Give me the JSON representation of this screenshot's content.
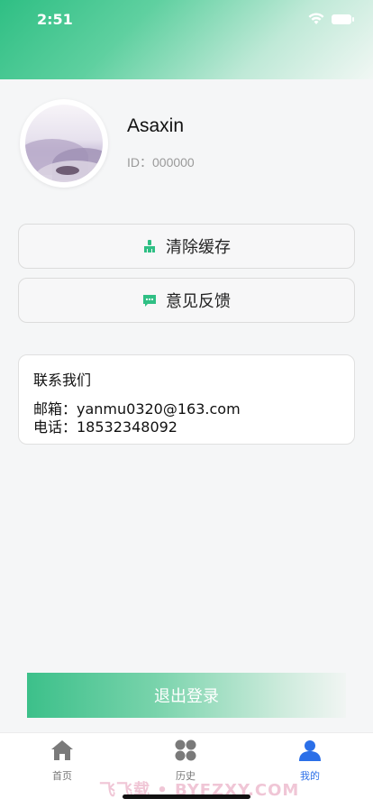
{
  "status_bar": {
    "time": "2:51"
  },
  "colors": {
    "accent_green": "#2fbf84",
    "active_tab": "#2b6fe8"
  },
  "profile": {
    "username": "Asaxin",
    "id_label": "ID：000000",
    "avatar": "landscape-avatar"
  },
  "actions": {
    "clear_cache_label": "清除缓存",
    "clear_cache_icon": "broom-icon",
    "feedback_label": "意见反馈",
    "feedback_icon": "chat-bubble-icon"
  },
  "contact": {
    "title": "联系我们",
    "email_line": "邮箱：yanmu0320@163.com",
    "phone_line": "电话：18532348092"
  },
  "logout": {
    "label": "退出登录"
  },
  "tabbar": {
    "tabs": [
      {
        "label": "首页",
        "icon": "home-icon",
        "active": false
      },
      {
        "label": "历史",
        "icon": "grid-icon",
        "active": false
      },
      {
        "label": "我的",
        "icon": "user-icon",
        "active": true
      }
    ]
  },
  "watermark": "飞飞载 • BYFZXY.COM"
}
